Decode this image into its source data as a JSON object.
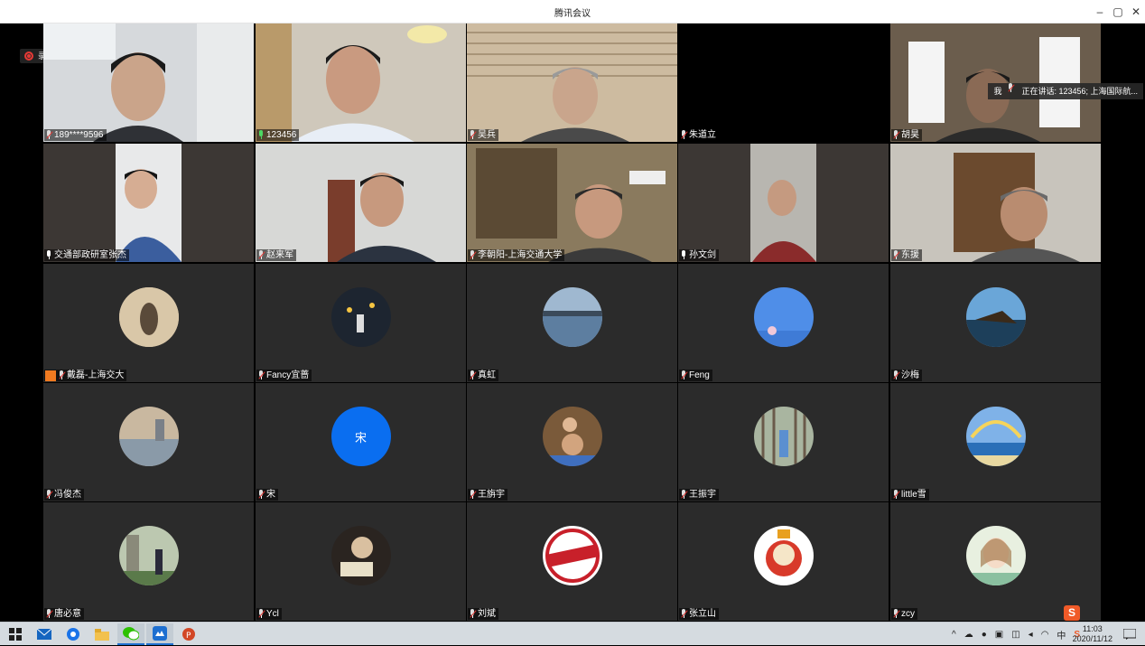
{
  "window": {
    "title": "腾讯会议",
    "minimize": "–",
    "restore": "▢",
    "close": "✕"
  },
  "recording": {
    "label": "录制中"
  },
  "speaking": {
    "me": "我",
    "text": "正在讲话: 123456; 上海国际航..."
  },
  "participants": [
    {
      "name": "189****9596"
    },
    {
      "name": "123456"
    },
    {
      "name": "吴兵"
    },
    {
      "name": "朱道立"
    },
    {
      "name": "胡昊"
    },
    {
      "name": "交通部政研室张杰"
    },
    {
      "name": "赵来军"
    },
    {
      "name": "李朝阳-上海交通大学"
    },
    {
      "name": "孙文剑"
    },
    {
      "name": "东援"
    },
    {
      "name": "戴磊-上海交大"
    },
    {
      "name": "Fancy宜蔷"
    },
    {
      "name": "真虹"
    },
    {
      "name": "Feng"
    },
    {
      "name": "沙梅"
    },
    {
      "name": "冯俊杰"
    },
    {
      "name": "宋",
      "avatar_letter": "宋"
    },
    {
      "name": "王旃宇"
    },
    {
      "name": "王振宇"
    },
    {
      "name": "little雪"
    },
    {
      "name": "唐必意"
    },
    {
      "name": "Ycl"
    },
    {
      "name": "刘斌"
    },
    {
      "name": "张立山"
    },
    {
      "name": "zcy"
    }
  ],
  "taskbar": {
    "ime": "中",
    "time": "11:03",
    "date": "2020/11/12"
  },
  "ime_logo": "S"
}
